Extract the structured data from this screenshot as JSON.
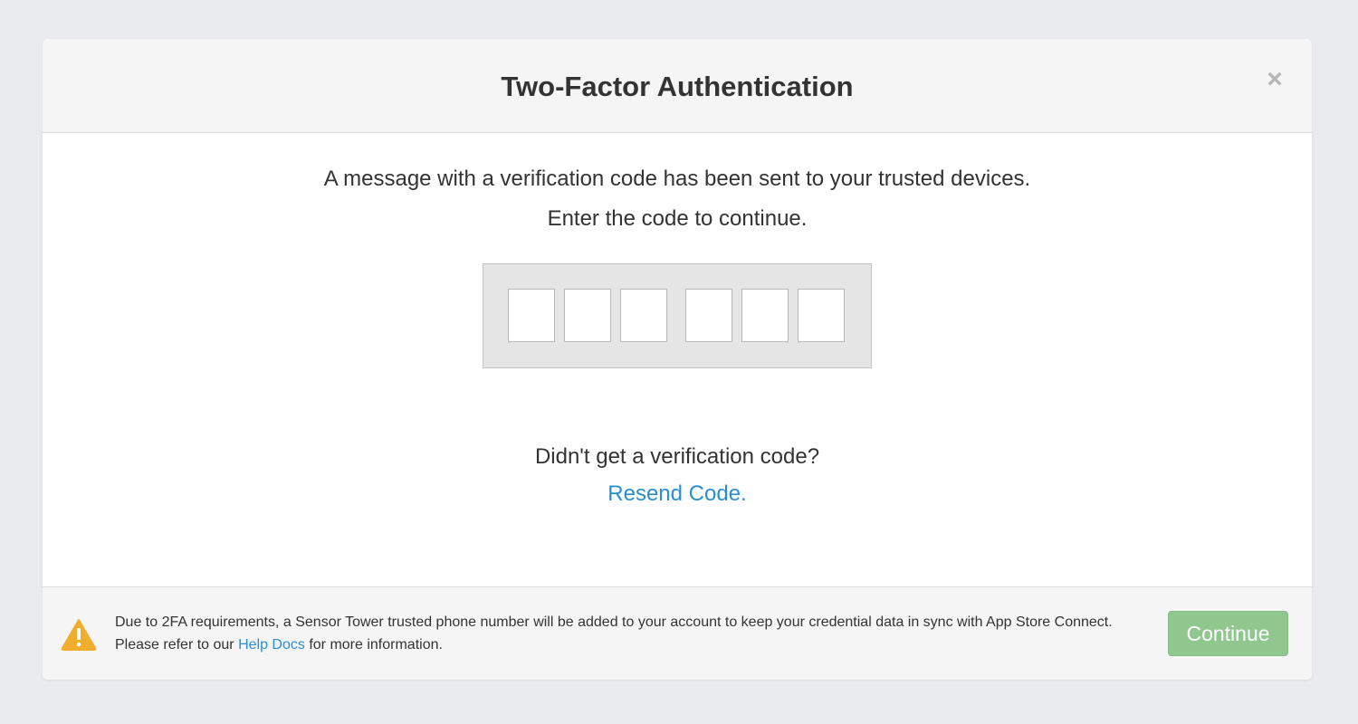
{
  "modal": {
    "title": "Two-Factor Authentication",
    "close_symbol": "×"
  },
  "body": {
    "message_line1": "A message with a verification code has been sent to your trusted devices.",
    "message_line2": "Enter the code to continue.",
    "code_digits": [
      "",
      "",
      "",
      "",
      "",
      ""
    ],
    "didnt_get_code": "Didn't get a verification code?",
    "resend_link": "Resend Code."
  },
  "footer": {
    "warning_icon": "warning-triangle-icon",
    "notice_before_link": "Due to 2FA requirements, a Sensor Tower trusted phone number will be added to your account to keep your credential data in sync with App Store Connect. Please refer to our ",
    "help_link": "Help Docs",
    "notice_after_link": " for more information.",
    "continue_label": "Continue"
  },
  "colors": {
    "background": "#e9ebef",
    "header_bg": "#f5f5f5",
    "link": "#2a8fd0",
    "continue_bg": "#8fc78f",
    "warning": "#f0ad2e"
  }
}
